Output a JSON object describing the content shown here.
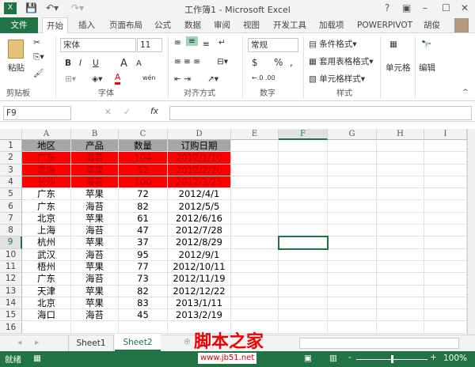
{
  "title": "工作簿1 - Microsoft Excel",
  "window_controls": {
    "help": "?",
    "restore": "▣",
    "min": "–",
    "max": "☐",
    "close": "✕"
  },
  "tabs": [
    "文件",
    "开始",
    "插入",
    "页面布局",
    "公式",
    "数据",
    "审阅",
    "视图",
    "开发工具",
    "加载项",
    "POWERPIVOT"
  ],
  "user": "胡俊",
  "ribbon": {
    "paste": "粘贴",
    "clipboard": "剪贴板",
    "font_name": "宋体",
    "font_size": "11",
    "font": "字体",
    "bold": "B",
    "italic": "I",
    "underline": "U",
    "grow": "A",
    "shrink": "A",
    "wen": "wén",
    "alignment": "对齐方式",
    "number_format": "常规",
    "currency": "$",
    "percent": "%",
    "comma": ",",
    "number": "数字",
    "cond_format": "条件格式",
    "table_format": "套用表格格式",
    "cell_style": "单元格样式",
    "styles": "样式",
    "cells": "单元格",
    "editing": "编辑"
  },
  "formula_bar": {
    "name_box": "F9",
    "fx": "fx",
    "cancel": "✕",
    "enter": "✓",
    "value": ""
  },
  "columns": [
    "A",
    "B",
    "C",
    "D",
    "E",
    "F",
    "G",
    "H",
    "I"
  ],
  "rows": [
    [
      "地区",
      "产品",
      "数量",
      "订购日期"
    ],
    [
      "广东",
      "海苔",
      "104",
      "2012/1/10"
    ],
    [
      "北海",
      "苹果",
      "52",
      "2012/2/20"
    ],
    [
      "长沙",
      "海苔",
      "100",
      "2012/3/25"
    ],
    [
      "广东",
      "苹果",
      "72",
      "2012/4/1"
    ],
    [
      "广东",
      "海苔",
      "82",
      "2012/5/5"
    ],
    [
      "北京",
      "苹果",
      "61",
      "2012/6/16"
    ],
    [
      "上海",
      "海苔",
      "47",
      "2012/7/28"
    ],
    [
      "杭州",
      "苹果",
      "37",
      "2012/8/29"
    ],
    [
      "武汉",
      "海苔",
      "95",
      "2012/9/1"
    ],
    [
      "梧州",
      "苹果",
      "77",
      "2012/10/11"
    ],
    [
      "广东",
      "海苔",
      "73",
      "2012/11/19"
    ],
    [
      "天津",
      "苹果",
      "82",
      "2012/12/22"
    ],
    [
      "北京",
      "苹果",
      "83",
      "2013/1/11"
    ],
    [
      "海口",
      "海苔",
      "45",
      "2013/2/19"
    ],
    [
      "",
      "",
      "",
      ""
    ]
  ],
  "row_numbers": [
    "1",
    "2",
    "3",
    "4",
    "5",
    "6",
    "7",
    "8",
    "9",
    "10",
    "11",
    "12",
    "13",
    "14",
    "15",
    "16"
  ],
  "sheets": [
    "Sheet1",
    "Sheet2"
  ],
  "active_sheet": "Sheet2",
  "status": {
    "ready": "就绪",
    "zoom": "100%"
  },
  "watermark": {
    "cn": "脚本之家",
    "url": "www.jb51.net"
  },
  "colors": {
    "excel_green": "#217346",
    "header_grey": "#a6a6a6",
    "highlight_red": "#ff0000"
  }
}
